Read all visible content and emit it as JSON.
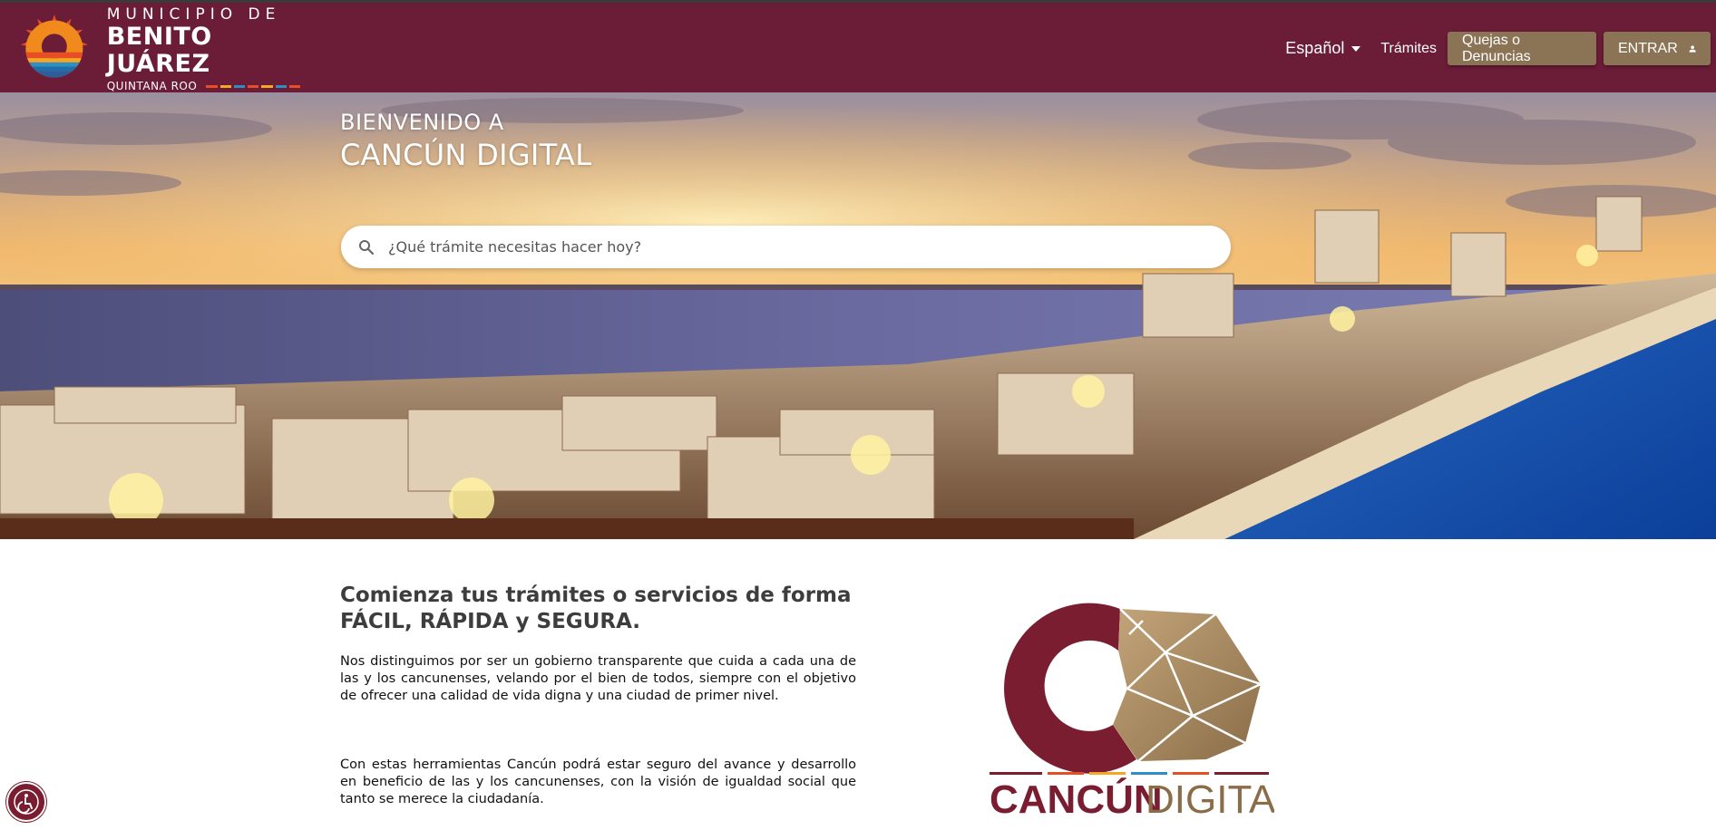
{
  "header": {
    "logo": {
      "line1": "MUNICIPIO DE",
      "line2": "BENITO JUÁREZ",
      "line3": "QUINTANA ROO"
    },
    "language": "Español",
    "tramites": "Trámites",
    "quejas_button": "Quejas o Denuncias",
    "login_button": "ENTRAR"
  },
  "hero": {
    "welcome": "BIENVENIDO A",
    "title": "CANCÚN DIGITAL",
    "search_placeholder": "¿Qué trámite necesitas hacer hoy?"
  },
  "intro": {
    "heading_line1": "Comienza tus trámites o servicios de forma",
    "heading_line2": "FÁCIL, RÁPIDA y SEGURA.",
    "paragraph1": "Nos distinguimos por ser un gobierno transparente que cuida a cada una de las y los cancunenses, velando por el bien de todos, siempre con el objetivo de ofrecer una calidad de vida digna y una ciudad de primer nivel.",
    "paragraph2": "Con estas herramientas Cancún podrá estar seguro del avance y desarrollo en beneficio de las y los cancunenses, con la visión de igualdad social que tanto se merece la ciudadanía."
  },
  "brand_logo": {
    "text_bold": "CANCÚN",
    "text_light": "DIGITAL"
  },
  "icons": {
    "search": "search-icon",
    "user": "user-icon",
    "caret": "caret-down-icon",
    "accessibility": "accessibility-icon"
  },
  "colors": {
    "header_bg": "#6b1c36",
    "button_gold": "#8b7355",
    "brand_maroon": "#7a1d30",
    "brand_gold": "#a88a5e"
  }
}
